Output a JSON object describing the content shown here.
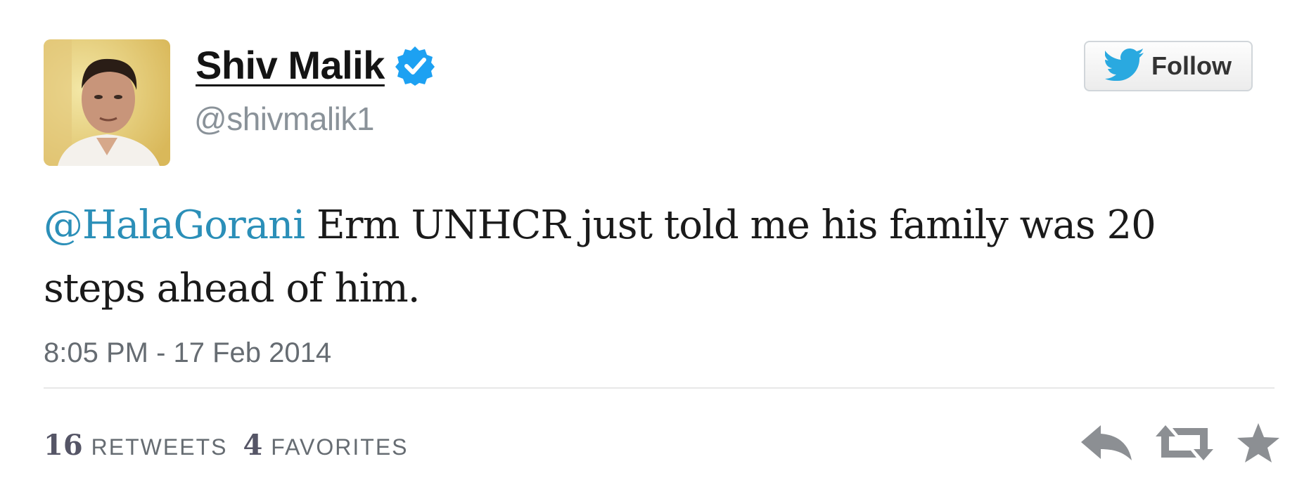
{
  "author": {
    "display_name": "Shiv Malik",
    "handle": "@shivmalik1",
    "verified_icon": "verified-badge-icon",
    "avatar": "profile-photo"
  },
  "follow_button": {
    "label": "Follow",
    "icon": "twitter-bird-icon"
  },
  "tweet": {
    "mention": "@HalaGorani",
    "text": " Erm UNHCR just told me his family was 20 steps ahead of him.",
    "timestamp": "8:05 PM - 17 Feb 2014"
  },
  "stats": {
    "retweets_count": "16",
    "retweets_label": "RETWEETS",
    "favorites_count": "4",
    "favorites_label": "FAVORITES"
  },
  "actions": {
    "reply_icon": "reply-icon",
    "retweet_icon": "retweet-icon",
    "favorite_icon": "star-icon"
  },
  "colors": {
    "mention_link": "#2b8fb8",
    "verified_badge": "#1da1f2",
    "twitter_bird": "#2aa9e0",
    "meta_text": "#666c72",
    "action_icons": "#8c8f93"
  }
}
